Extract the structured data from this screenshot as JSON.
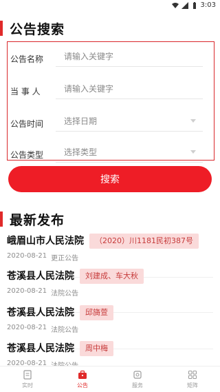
{
  "statusbar": {
    "time": "3:03"
  },
  "search_section": {
    "title": "公告搜索",
    "fields": [
      {
        "label": "公告名称",
        "placeholder": "请输入关键字"
      },
      {
        "label": "当 事 人",
        "placeholder": "请输入关键字"
      },
      {
        "label": "公告时间",
        "placeholder": "选择日期"
      },
      {
        "label": "公告类型",
        "placeholder": "选择类型"
      }
    ],
    "search_button": "搜索"
  },
  "latest_section": {
    "title": "最新发布",
    "items": [
      {
        "court": "峨眉山市人民法院",
        "tag": "（2020）川1181民初387号",
        "date": "2020-08-21",
        "type": "更正公告"
      },
      {
        "court": "苍溪县人民法院",
        "tag": "刘建成、车大秋",
        "date": "2020-08-21",
        "type": "法院公告"
      },
      {
        "court": "苍溪县人民法院",
        "tag": "邱旖萱",
        "date": "2020-08-21",
        "type": "法院公告"
      },
      {
        "court": "苍溪县人民法院",
        "tag": "周中梅",
        "date": "2020-08-21",
        "type": "法院公告"
      }
    ]
  },
  "tabbar": {
    "tabs": [
      {
        "label": "实时",
        "icon": "document-icon"
      },
      {
        "label": "公告",
        "icon": "briefcase-icon",
        "active": true
      },
      {
        "label": "服务",
        "icon": "service-icon"
      },
      {
        "label": "矩阵",
        "icon": "grid-icon"
      }
    ]
  },
  "colors": {
    "accent": "#ee1d26",
    "tag_bg": "#fadada",
    "tag_text": "#c63a3a"
  }
}
